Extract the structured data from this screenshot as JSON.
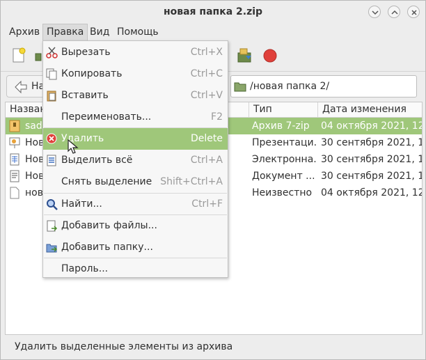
{
  "window": {
    "title": "новая папка 2.zip"
  },
  "menubar": {
    "items": [
      {
        "label": "Архив"
      },
      {
        "label": "Правка"
      },
      {
        "label": "Вид"
      },
      {
        "label": "Помощь"
      }
    ]
  },
  "location": {
    "back_label": "На",
    "path": "/новая папка 2/"
  },
  "filelist": {
    "columns": [
      "Назван",
      "Тип",
      "Дата изменения"
    ],
    "rows": [
      {
        "name": "sad",
        "type": "Архив 7-zip",
        "date": "04 октября 2021, 12...",
        "icon": "archive-icon"
      },
      {
        "name": "Нов",
        "type": "Презентаци...",
        "date": "30 сентября 2021, 1...",
        "icon": "presentation-icon"
      },
      {
        "name": "Нов",
        "type": "Электронна...",
        "date": "30 сентября 2021, 1...",
        "icon": "spreadsheet-icon"
      },
      {
        "name": "Нов",
        "type": "Документ ...",
        "date": "30 сентября 2021, 1...",
        "icon": "document-icon"
      },
      {
        "name": "нов",
        "type": "Неизвестно",
        "date": "04 октября 2021, 12...",
        "icon": "file-icon"
      }
    ]
  },
  "edit_menu": {
    "items": [
      {
        "label": "Вырезать",
        "accel": "Ctrl+X",
        "icon": "scissors-icon"
      },
      {
        "label": "Копировать",
        "accel": "Ctrl+C",
        "icon": "copy-icon"
      },
      {
        "label": "Вставить",
        "accel": "Ctrl+V",
        "icon": "paste-icon"
      },
      {
        "label": "Переименовать...",
        "accel": "F2",
        "icon": ""
      },
      {
        "label": "Удалить",
        "accel": "Delete",
        "icon": "delete-icon"
      },
      {
        "label": "Выделить всё",
        "accel": "Ctrl+A",
        "icon": "select-all-icon"
      },
      {
        "label": "Снять выделение",
        "accel": "Shift+Ctrl+A",
        "icon": ""
      },
      {
        "label": "Найти...",
        "accel": "Ctrl+F",
        "icon": "search-icon"
      },
      {
        "label": "Добавить файлы...",
        "accel": "",
        "icon": "add-files-icon"
      },
      {
        "label": "Добавить папку...",
        "accel": "",
        "icon": "add-folder-icon"
      },
      {
        "label": "Пароль...",
        "accel": "",
        "icon": ""
      }
    ]
  },
  "statusbar": {
    "text": "Удалить выделенные элементы из архива"
  },
  "colors": {
    "selection": "#9fc77a",
    "delete_icon": "#e0403a"
  }
}
